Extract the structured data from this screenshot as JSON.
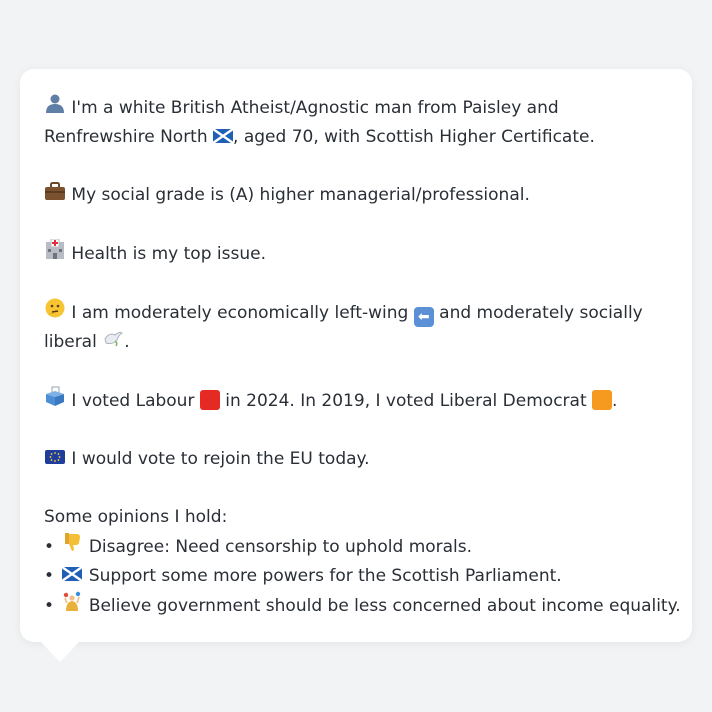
{
  "identity": {
    "icon": "person-silhouette-icon",
    "text_before_flag": "I'm a white British Atheist/Agnostic man from Paisley and Renfrewshire North",
    "flag_icon": "scotland-flag-icon",
    "text_after_flag": ", aged 70, with Scottish Higher Certificate."
  },
  "social_grade": {
    "icon": "briefcase-icon",
    "text": "My social grade is (A) higher managerial/professional."
  },
  "top_issue": {
    "icon": "hospital-icon",
    "text": "Health is my top issue."
  },
  "ideology": {
    "icon": "thinking-face-icon",
    "text_part1": "I am moderately economically left-wing",
    "left_arrow_icon": "left-arrow-icon",
    "text_part2": "and moderately socially liberal",
    "dove_icon": "dove-icon",
    "text_end": "."
  },
  "votes": {
    "icon": "ballot-box-icon",
    "text_part1": "I voted Labour",
    "labour_color": "#e52a23",
    "text_part2": "in 2024. In 2019, I voted Liberal Democrat",
    "libdem_color": "#f59a1e",
    "text_end": "."
  },
  "eu": {
    "icon": "eu-flag-icon",
    "text": "I would vote to rejoin the EU today."
  },
  "opinions": {
    "heading": "Some opinions I hold:",
    "items": [
      {
        "bullet": "•",
        "icon": "thumbs-down-icon",
        "text": "Disagree: Need censorship to uphold morals."
      },
      {
        "bullet": "•",
        "icon": "scotland-flag-icon",
        "text": "Support some more powers for the Scottish Parliament."
      },
      {
        "bullet": "•",
        "icon": "juggling-person-icon",
        "text": "Believe government should be less concerned about income equality."
      }
    ]
  }
}
